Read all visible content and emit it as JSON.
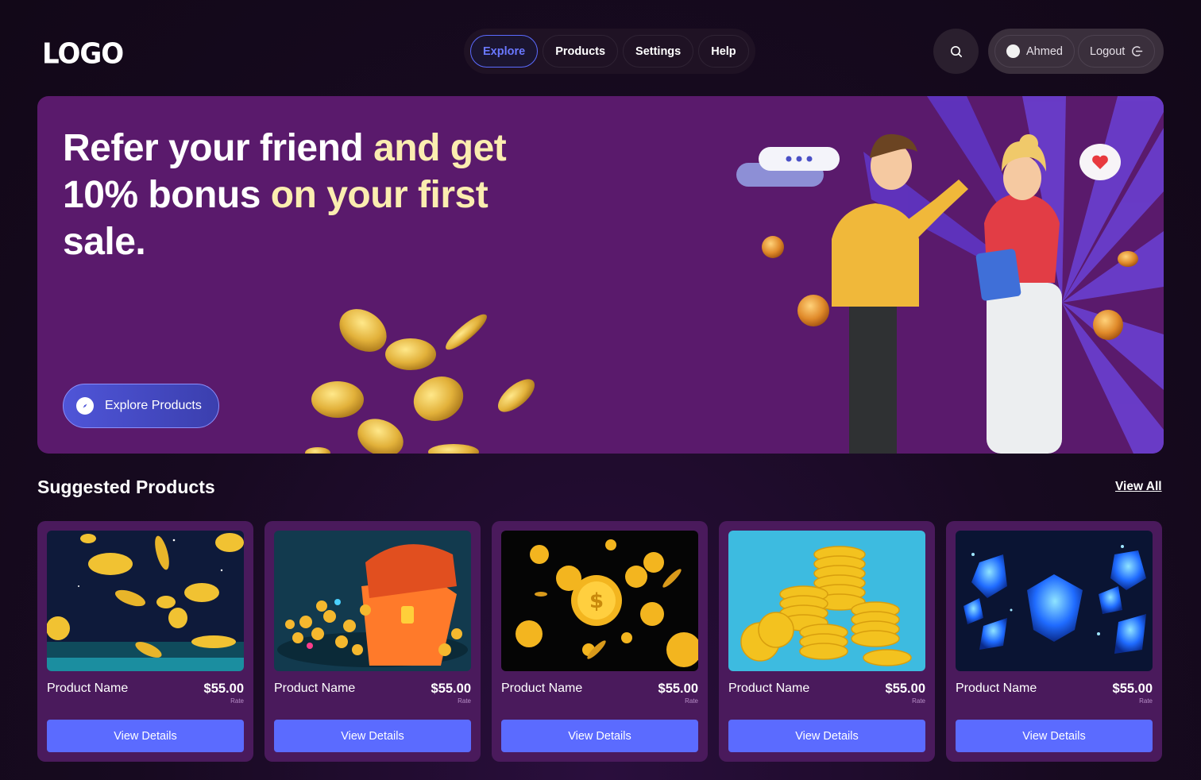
{
  "header": {
    "logo": "LOGO",
    "nav": [
      {
        "label": "Explore",
        "active": true
      },
      {
        "label": "Products",
        "active": false
      },
      {
        "label": "Settings",
        "active": false
      },
      {
        "label": "Help",
        "active": false
      }
    ],
    "search_icon": "search-icon",
    "user": {
      "name": "Ahmed",
      "logout_label": "Logout",
      "logout_icon": "logout-icon"
    }
  },
  "hero": {
    "title_line1_white": "Refer your friend ",
    "title_line1_yellow": "and get",
    "title_line2_white": "10% bonus ",
    "title_line2_yellow": "on your first",
    "title_line3_white": "sale.",
    "cta_label": "Explore Products",
    "cta_icon": "compass-icon",
    "colors": {
      "background": "#5a1a6c",
      "highlight": "#fbedb0",
      "cta": "#4f55d8"
    }
  },
  "suggested": {
    "title": "Suggested Products",
    "view_all_label": "View All",
    "products": [
      {
        "name": "Product Name",
        "price": "$55.00",
        "rate_label": "Rate",
        "button": "View Details",
        "image": "falling-coins-night"
      },
      {
        "name": "Product Name",
        "price": "$55.00",
        "rate_label": "Rate",
        "button": "View Details",
        "image": "treasure-chest"
      },
      {
        "name": "Product Name",
        "price": "$55.00",
        "rate_label": "Rate",
        "button": "View Details",
        "image": "dollar-coins-black"
      },
      {
        "name": "Product Name",
        "price": "$55.00",
        "rate_label": "Rate",
        "button": "View Details",
        "image": "coin-stacks-cyan"
      },
      {
        "name": "Product Name",
        "price": "$55.00",
        "rate_label": "Rate",
        "button": "View Details",
        "image": "blue-gems"
      }
    ]
  },
  "colors": {
    "accent": "#5b6bff",
    "card": "#4a1a5c",
    "page": "#170a20"
  }
}
